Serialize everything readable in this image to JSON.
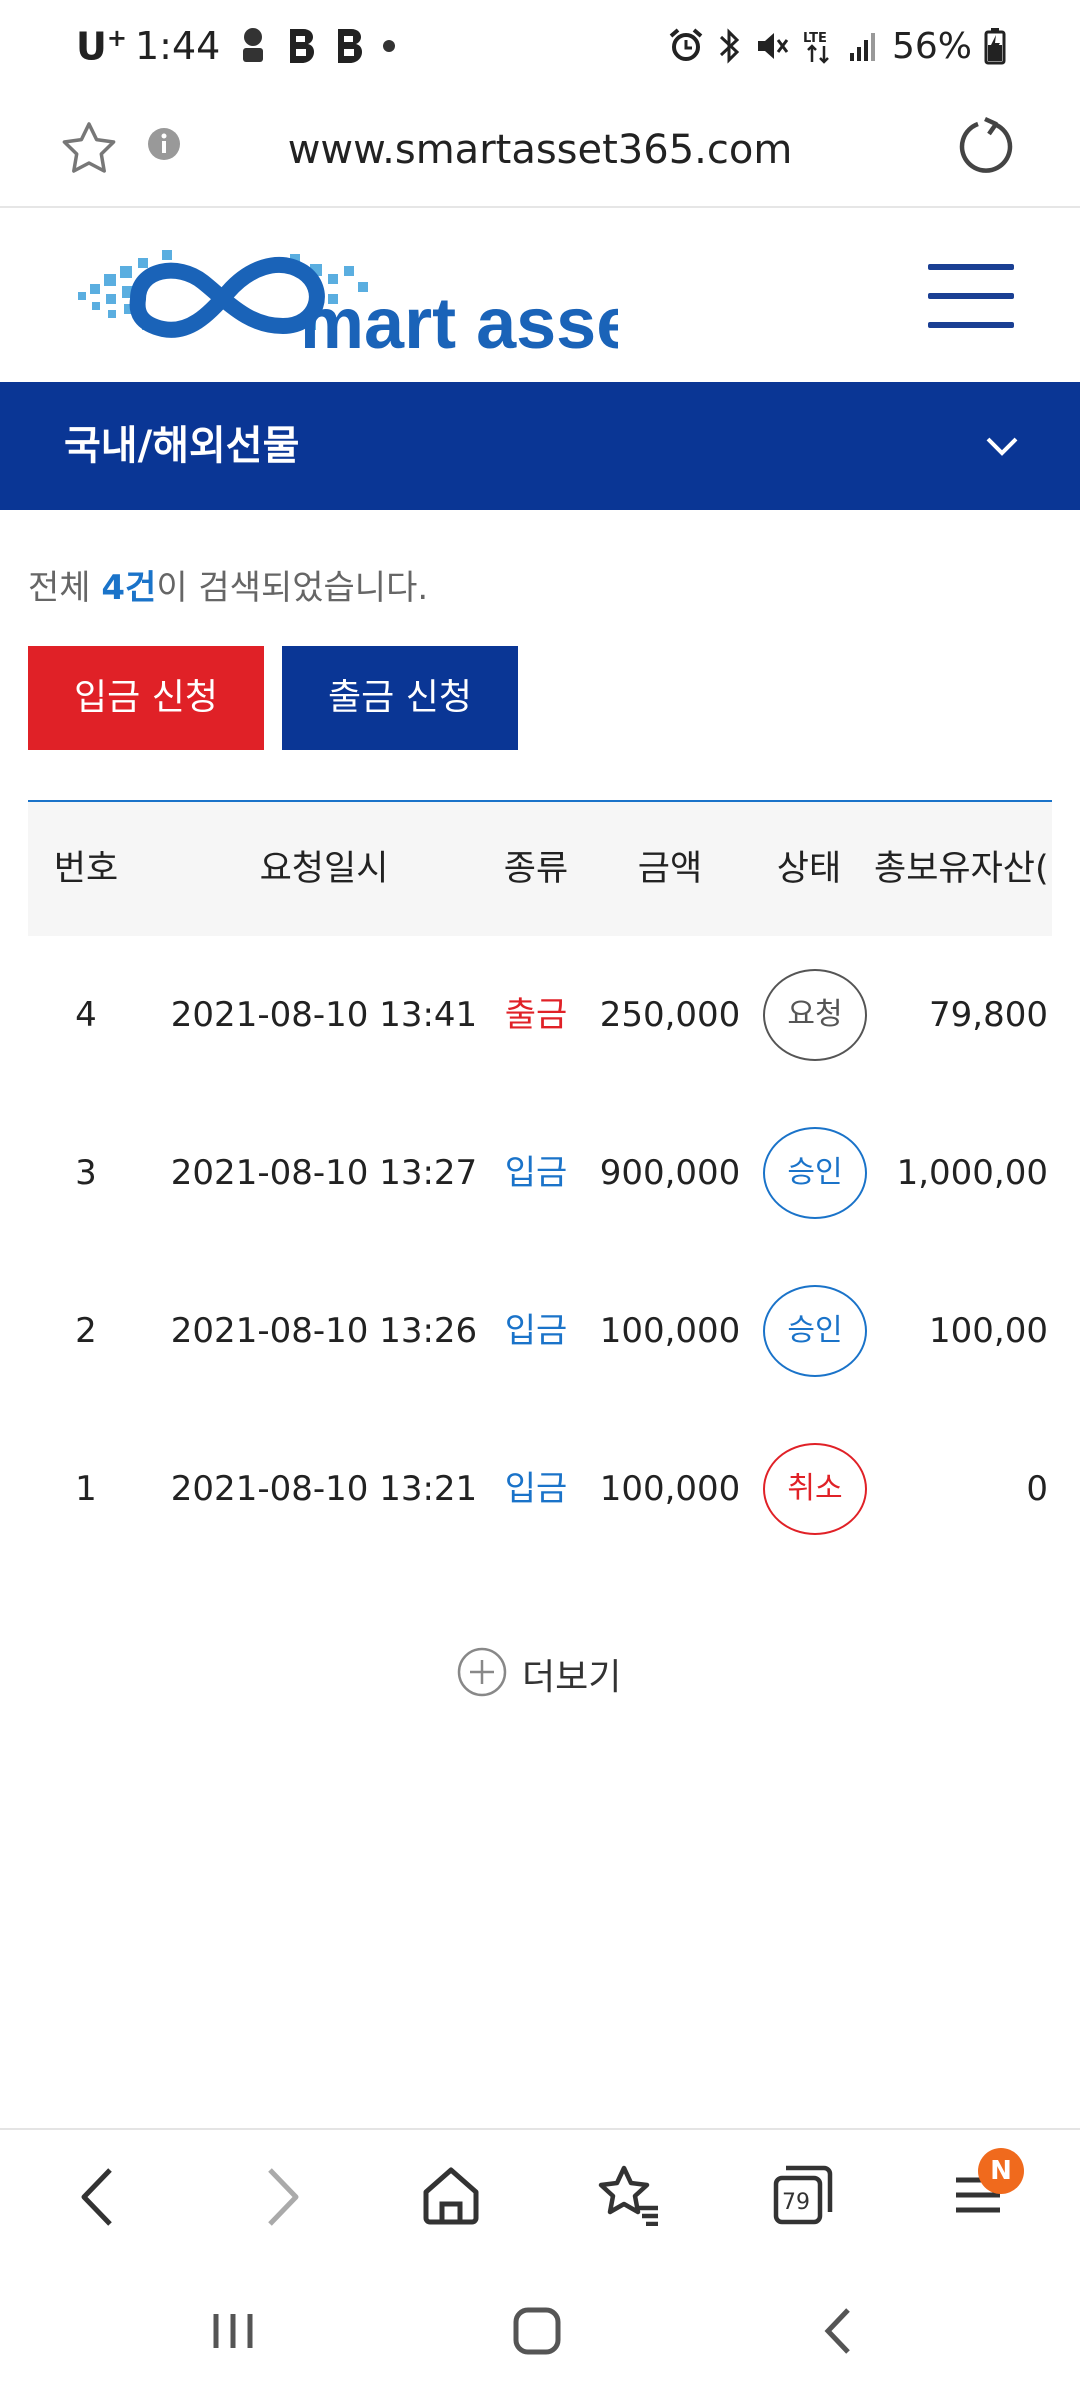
{
  "status_bar": {
    "carrier": "U",
    "carrier_sup": "+",
    "time": "1:44",
    "battery": "56%",
    "icons": [
      "headset-icon",
      "b-icon",
      "b-icon",
      "dot-icon",
      "alarm-icon",
      "bluetooth-icon",
      "mute-icon",
      "lte-icon",
      "signal-icon",
      "battery-icon"
    ]
  },
  "browser": {
    "url": "www.smartasset365.com",
    "tabs_count": "79",
    "notification_badge": "N"
  },
  "header": {
    "logo_text": "mart asset",
    "brand_color": "#1a63b8"
  },
  "category": {
    "title": "국내/해외선물"
  },
  "results": {
    "prefix": "전체 ",
    "count": "4건",
    "suffix": "이 검색되었습니다."
  },
  "buttons": {
    "deposit": "입금 신청",
    "withdraw": "출금 신청"
  },
  "table": {
    "headers": [
      "번호",
      "요청일시",
      "종류",
      "금액",
      "상태",
      "총보유자산("
    ],
    "rows": [
      {
        "no": "4",
        "date": "2021-08-10 13:41",
        "type": "출금",
        "amount": "250,000",
        "status": "요청",
        "total": "79,800"
      },
      {
        "no": "3",
        "date": "2021-08-10 13:27",
        "type": "입금",
        "amount": "900,000",
        "status": "승인",
        "total": "1,000,00"
      },
      {
        "no": "2",
        "date": "2021-08-10 13:26",
        "type": "입금",
        "amount": "100,000",
        "status": "승인",
        "total": "100,00"
      },
      {
        "no": "1",
        "date": "2021-08-10 13:21",
        "type": "입금",
        "amount": "100,000",
        "status": "취소",
        "total": "0"
      }
    ]
  },
  "more": {
    "label": "더보기"
  },
  "colors": {
    "navy": "#0a3695",
    "red": "#e02127",
    "blue": "#1a73c9"
  }
}
